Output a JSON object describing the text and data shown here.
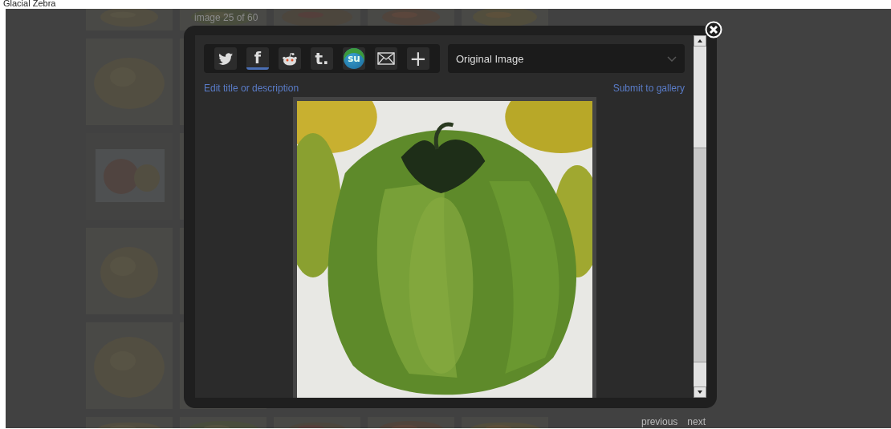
{
  "page_title": "Glacial Zebra",
  "counter": "image 25 of 60",
  "share_buttons": [
    {
      "kind": "twitter"
    },
    {
      "kind": "facebook",
      "label": "f"
    },
    {
      "kind": "reddit"
    },
    {
      "kind": "tumblr",
      "label": "t."
    },
    {
      "kind": "stumbleupon",
      "label": "su"
    },
    {
      "kind": "email"
    },
    {
      "kind": "more",
      "label": "+"
    }
  ],
  "size_select": {
    "value": "Original Image"
  },
  "links": {
    "edit": "Edit title or description",
    "submit": "Submit to gallery"
  },
  "navigation": {
    "previous": "previous",
    "next": "next"
  }
}
